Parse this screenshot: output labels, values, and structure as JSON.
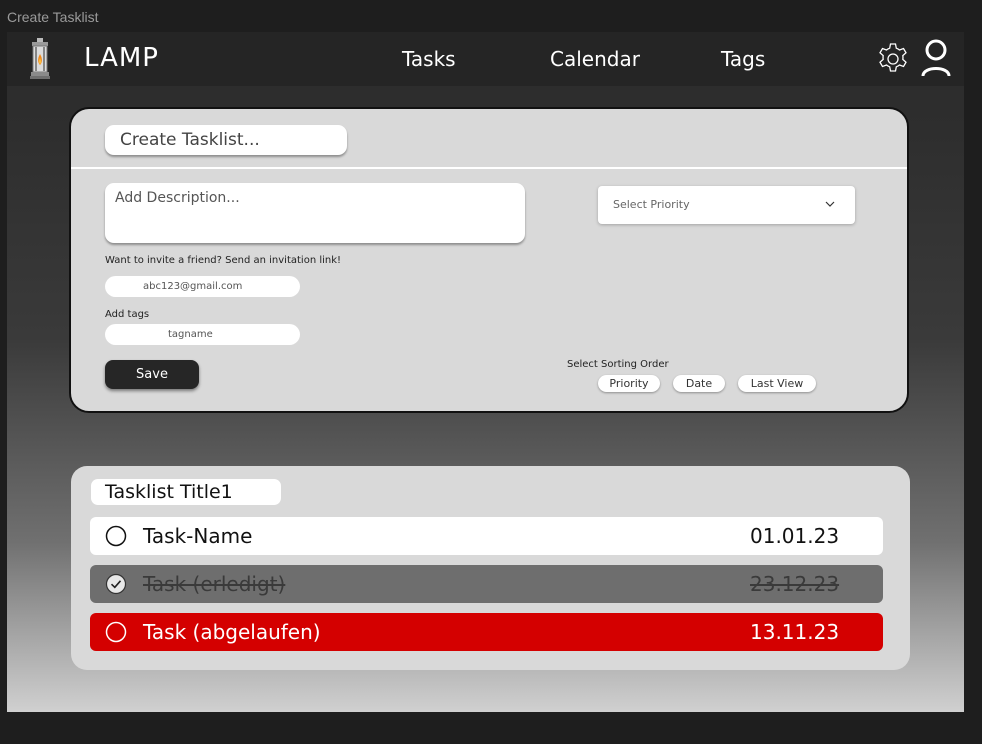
{
  "window": {
    "title": "Create Tasklist"
  },
  "navbar": {
    "brand": "LAMP",
    "links": [
      "Tasks",
      "Calendar",
      "Tags"
    ]
  },
  "create_form": {
    "title_placeholder": "Create Tasklist...",
    "description_placeholder": "Add Description...",
    "priority_select": {
      "placeholder": "Select Priority"
    },
    "invite": {
      "label": "Want to invite a friend? Send an invitation link!",
      "email_value": "abc123@gmail.com"
    },
    "tags": {
      "label": "Add tags",
      "value": "tagname"
    },
    "save_label": "Save",
    "sorting": {
      "label": "Select Sorting Order",
      "options": [
        "Priority",
        "Date",
        "Last View"
      ]
    }
  },
  "tasklist": {
    "title": "Tasklist Title1",
    "tasks": [
      {
        "name": "Task-Name",
        "date": "01.01.23",
        "state": "open"
      },
      {
        "name": "Task (erledigt)",
        "date": "23.12.23",
        "state": "done"
      },
      {
        "name": "Task (abgelaufen)",
        "date": "13.11.23",
        "state": "overdue"
      }
    ]
  },
  "colors": {
    "navbar": "#252525",
    "card": "#d9d9d9",
    "done_row": "#6e6e6e",
    "overdue_row": "#d40000",
    "save_button": "#262626"
  },
  "icons": [
    "lamp-icon",
    "gear-icon",
    "user-icon",
    "chevron-down-icon",
    "radio-circle-icon",
    "check-circle-icon"
  ]
}
